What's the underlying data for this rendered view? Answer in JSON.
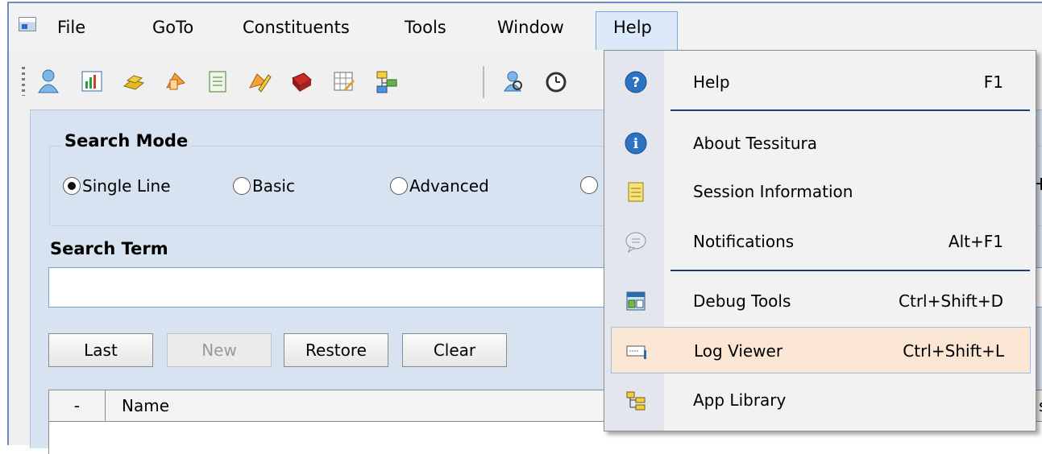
{
  "menubar": {
    "items": [
      {
        "label": "File"
      },
      {
        "label": "GoTo"
      },
      {
        "label": "Constituents"
      },
      {
        "label": "Tools"
      },
      {
        "label": "Window"
      },
      {
        "label": "Help"
      }
    ]
  },
  "search_panel": {
    "group_title": "Search Mode",
    "modes": [
      {
        "label": "Single Line",
        "selected": true
      },
      {
        "label": "Basic",
        "selected": false
      },
      {
        "label": "Advanced",
        "selected": false
      }
    ],
    "search_term_label": "Search Term",
    "search_value": "",
    "buttons": {
      "last": "Last",
      "new": "New",
      "restore": "Restore",
      "clear": "Clear"
    },
    "grid": {
      "col_dash": "-",
      "col_name": "Name",
      "right_clip_text": "s",
      "right_clip_group": "H"
    }
  },
  "help_menu": {
    "items": [
      {
        "label": "Help",
        "shortcut": "F1",
        "icon": "help-icon"
      },
      {
        "label": "About Tessitura",
        "shortcut": "",
        "icon": "info-icon"
      },
      {
        "label": "Session Information",
        "shortcut": "",
        "icon": "notepad-icon"
      },
      {
        "label": "Notifications",
        "shortcut": "Alt+F1",
        "icon": "speech-bubble-icon"
      },
      {
        "label": "Debug Tools",
        "shortcut": "Ctrl+Shift+D",
        "icon": "debug-tools-icon"
      },
      {
        "label": "Log Viewer",
        "shortcut": "Ctrl+Shift+L",
        "icon": "log-viewer-icon",
        "highlighted": true
      },
      {
        "label": "App Library",
        "shortcut": "",
        "icon": "app-library-icon"
      }
    ]
  },
  "colors": {
    "menu_active_bg": "#dbe9f8",
    "item_highlight_bg": "#fbe6d3",
    "panel_bg": "#d8e3f1",
    "separator": "#1f3e7a"
  }
}
